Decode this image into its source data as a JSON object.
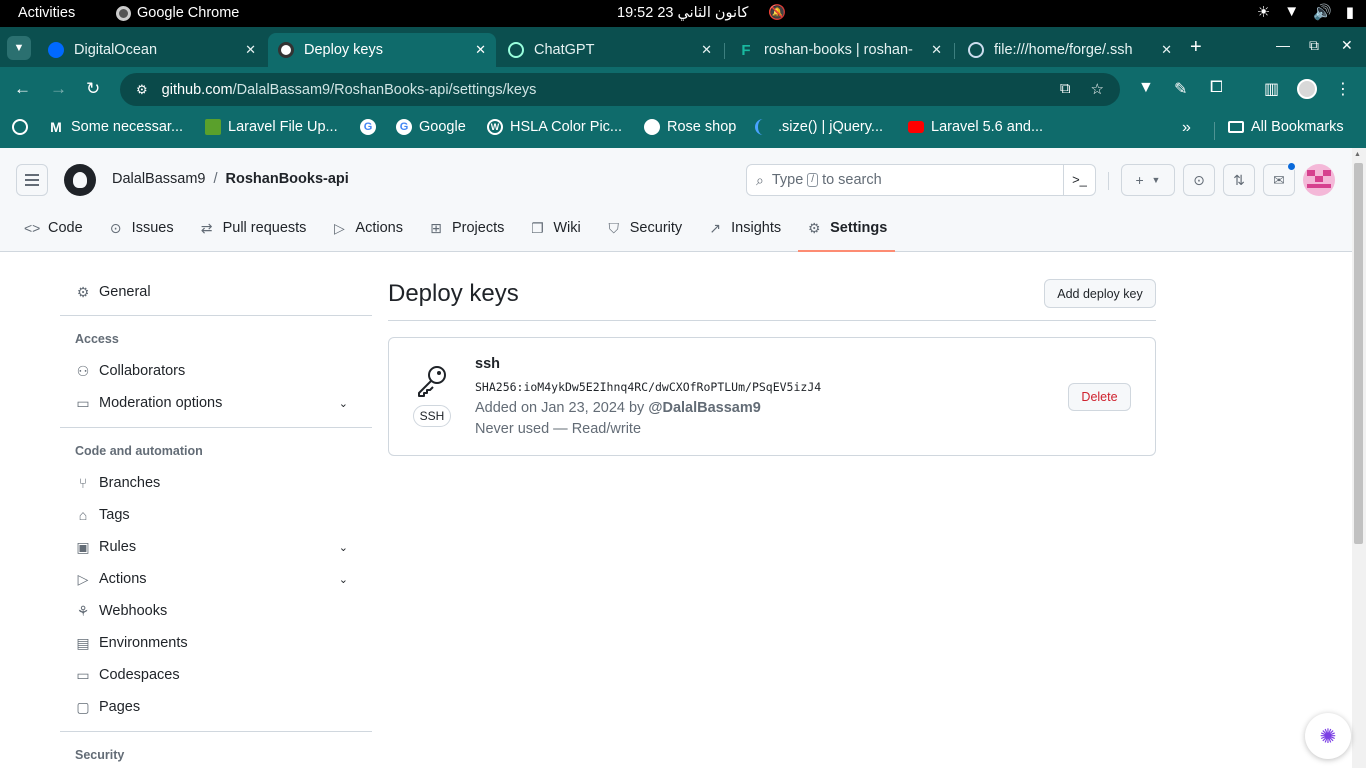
{
  "os_bar": {
    "activities": "Activities",
    "app_name": "Google Chrome",
    "clock": "كانون الثاني 23  19:52"
  },
  "tabs": [
    {
      "title": "DigitalOcean",
      "icon": "digitalocean-icon",
      "active": false
    },
    {
      "title": "Deploy keys",
      "icon": "github-icon",
      "active": true
    },
    {
      "title": "ChatGPT",
      "icon": "chatgpt-icon",
      "active": false
    },
    {
      "title": "roshan-books | roshan-",
      "icon": "forge-icon",
      "active": false
    },
    {
      "title": "file:///home/forge/.ssh",
      "icon": "globe-icon",
      "active": false
    }
  ],
  "address_bar": {
    "host": "github.com",
    "path": "/DalalBassam9/RoshanBooks-api/settings/keys"
  },
  "bookmarks": [
    {
      "label": "Some necessar...",
      "icon": "M"
    },
    {
      "label": "Laravel File Up...",
      "icon": "leaf"
    },
    {
      "label": "",
      "icon": "G"
    },
    {
      "label": "Google",
      "icon": "G"
    },
    {
      "label": "HSLA Color Pic...",
      "icon": "wordpress"
    },
    {
      "label": "Rose shop",
      "icon": "globe"
    },
    {
      "label": ".size() | jQuery...",
      "icon": "jquery"
    },
    {
      "label": "Laravel 5.6 and...",
      "icon": "youtube"
    }
  ],
  "all_bookmarks": "All Bookmarks",
  "github": {
    "owner": "DalalBassam9",
    "separator": "/",
    "repo": "RoshanBooks-api",
    "search_before": "Type",
    "search_key": "/",
    "search_after": "to search",
    "repo_nav": [
      {
        "label": "Code",
        "icon": "code-icon",
        "glyph": "<>"
      },
      {
        "label": "Issues",
        "icon": "issue-icon",
        "glyph": "⊙"
      },
      {
        "label": "Pull requests",
        "icon": "pull-request-icon",
        "glyph": "⇄"
      },
      {
        "label": "Actions",
        "icon": "play-icon",
        "glyph": "▷"
      },
      {
        "label": "Projects",
        "icon": "table-icon",
        "glyph": "⊞"
      },
      {
        "label": "Wiki",
        "icon": "book-icon",
        "glyph": "❐"
      },
      {
        "label": "Security",
        "icon": "shield-icon",
        "glyph": "⛉"
      },
      {
        "label": "Insights",
        "icon": "graph-icon",
        "glyph": "↗"
      },
      {
        "label": "Settings",
        "icon": "gear-icon",
        "glyph": "⚙"
      }
    ]
  },
  "sidebar": {
    "general": "General",
    "access_heading": "Access",
    "collaborators": "Collaborators",
    "moderation": "Moderation options",
    "code_heading": "Code and automation",
    "branches": "Branches",
    "tags": "Tags",
    "rules": "Rules",
    "actions": "Actions",
    "webhooks": "Webhooks",
    "environments": "Environments",
    "codespaces": "Codespaces",
    "pages": "Pages",
    "security_heading": "Security"
  },
  "main": {
    "title": "Deploy keys",
    "add_button": "Add deploy key",
    "key": {
      "name": "ssh",
      "badge": "SSH",
      "fingerprint": "SHA256:ioM4ykDw5E2Ihnq4RC/dwCXOfRoPTLUm/PSqEV5izJ4",
      "added_prefix": "Added on Jan 23, 2024 by",
      "added_by": "@DalalBassam9",
      "usage": "Never used — Read/write",
      "delete_button": "Delete"
    }
  }
}
